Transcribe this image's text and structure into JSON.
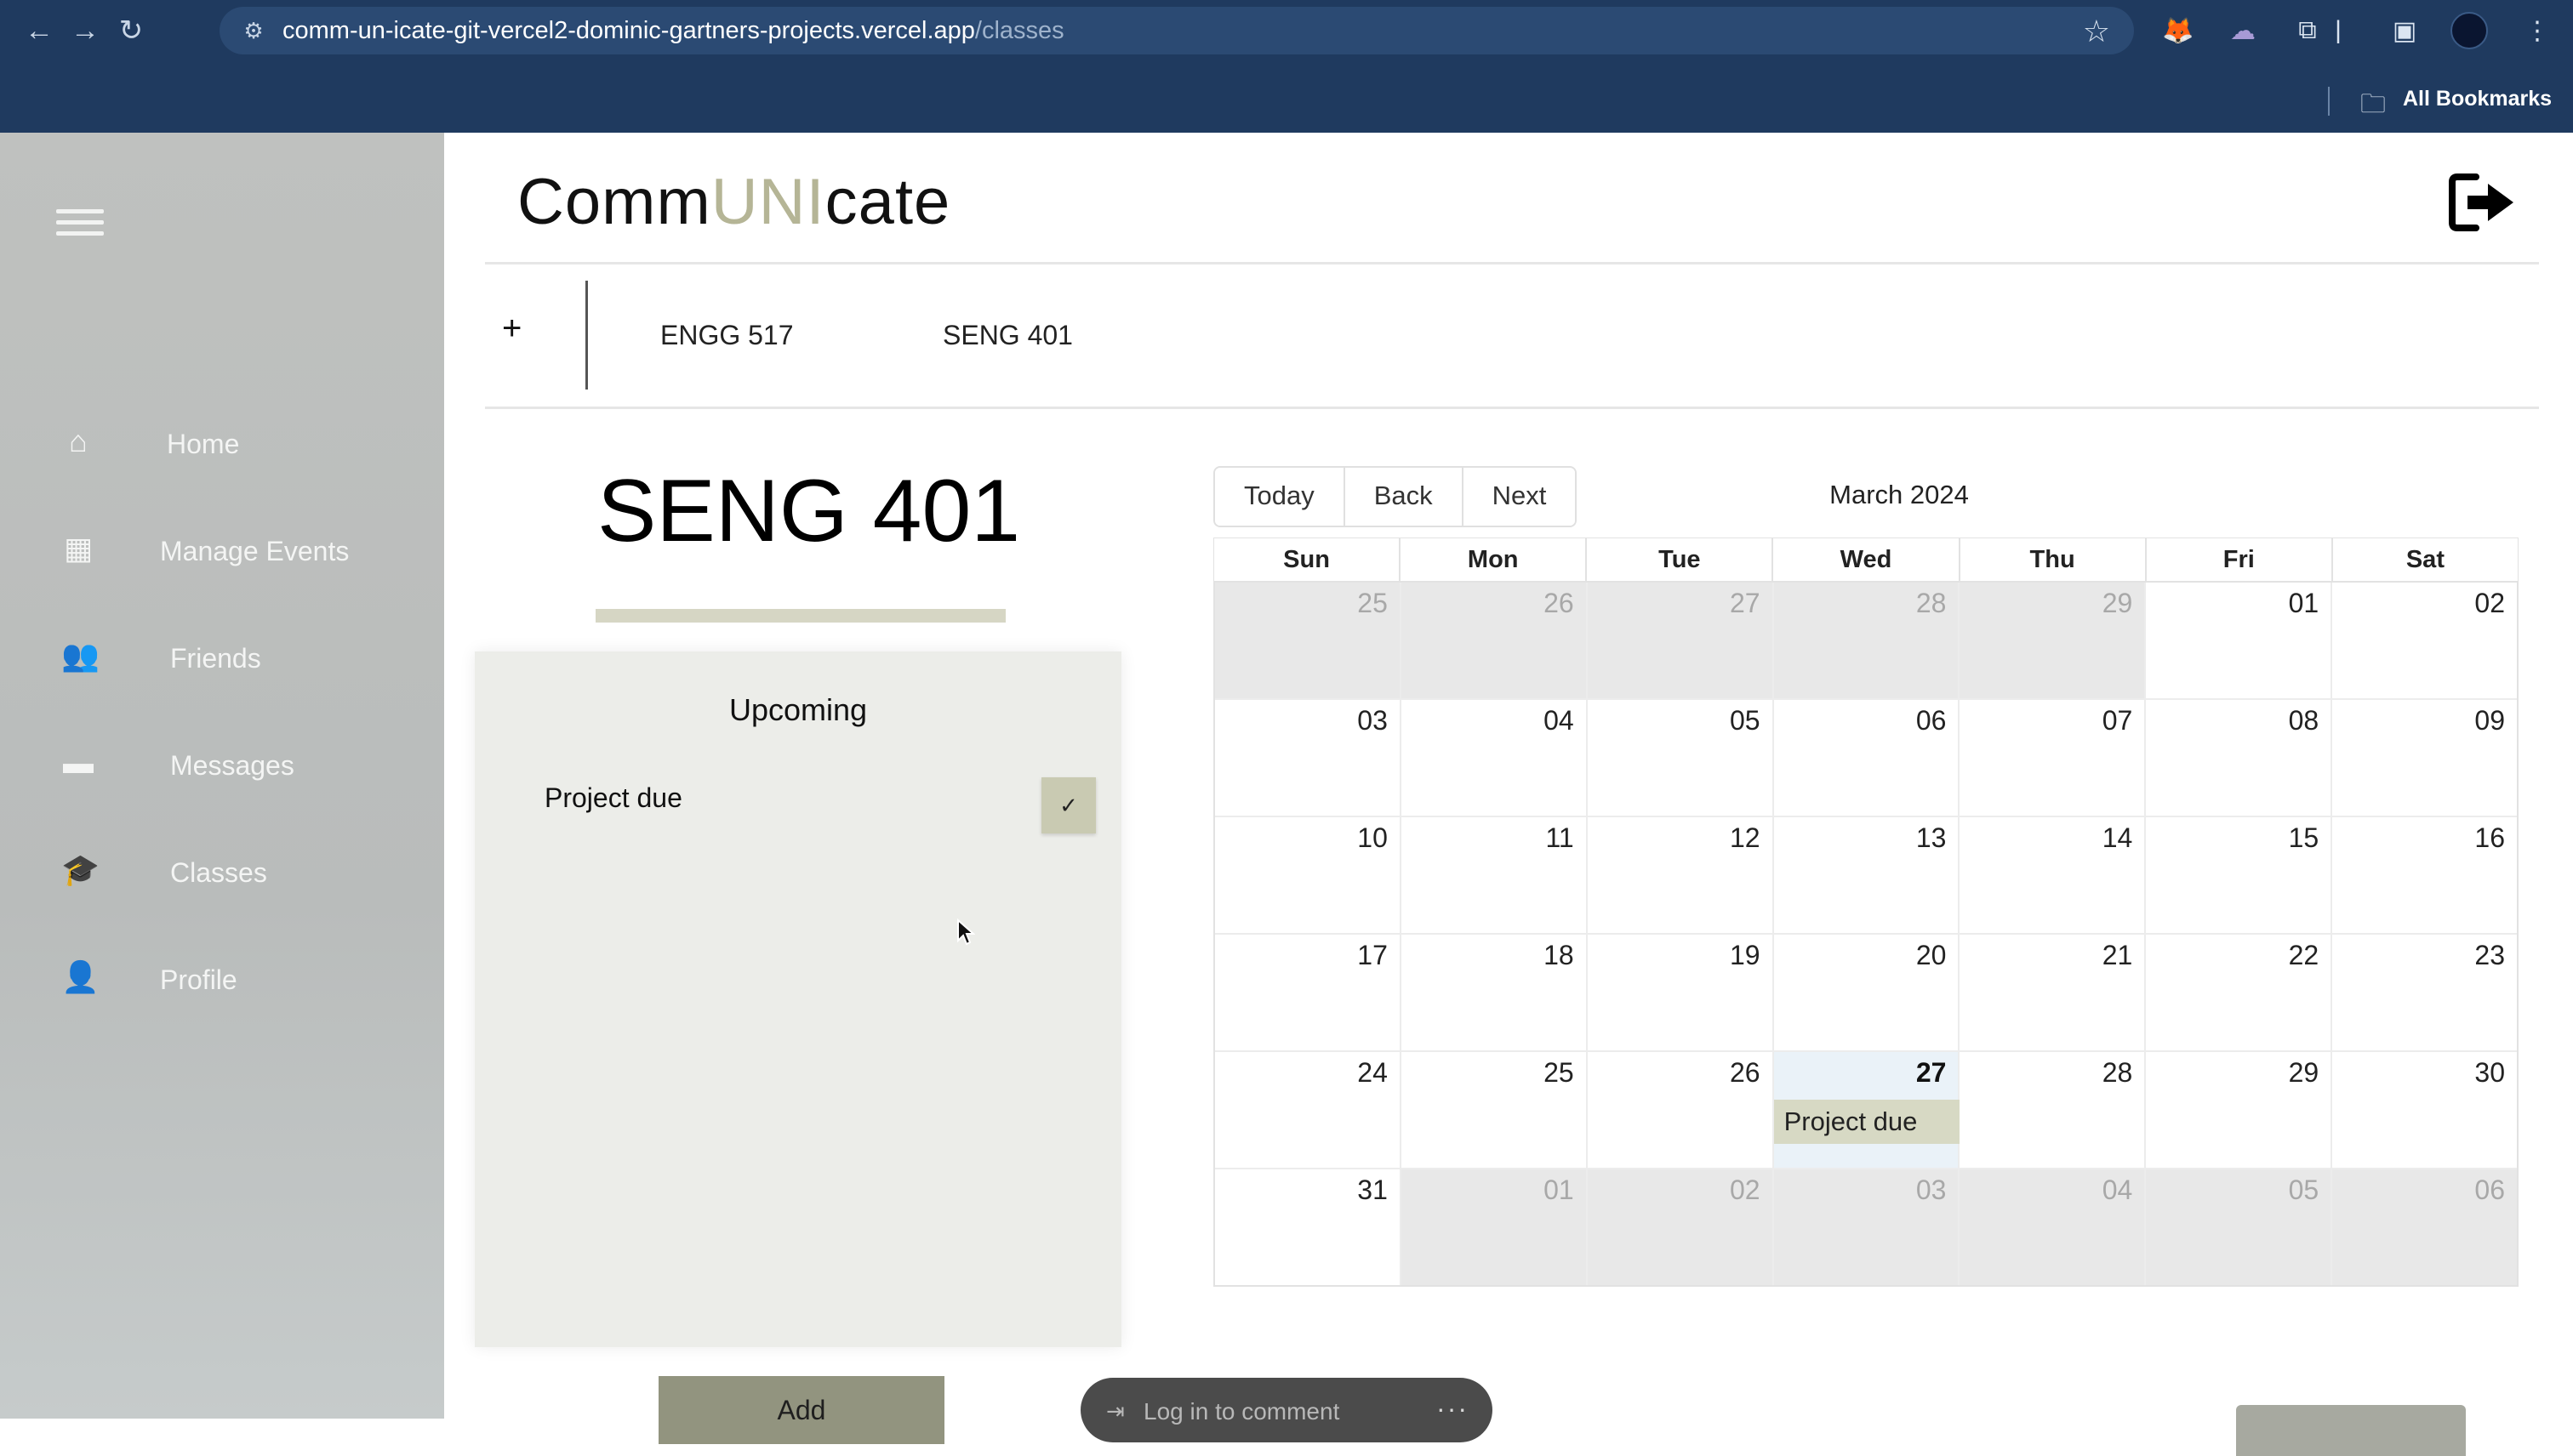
{
  "browser": {
    "url_host": "comm-un-icate-git-vercel2-dominic-gartners-projects.vercel.app",
    "url_path": "/classes",
    "bookmarks_label": "All Bookmarks"
  },
  "sidebar": {
    "items": [
      {
        "label": "Home",
        "icon": "home-icon"
      },
      {
        "label": "Manage Events",
        "icon": "calendar-icon"
      },
      {
        "label": "Friends",
        "icon": "users-icon"
      },
      {
        "label": "Messages",
        "icon": "message-icon"
      },
      {
        "label": "Classes",
        "icon": "graduation-cap-icon"
      },
      {
        "label": "Profile",
        "icon": "user-icon"
      }
    ]
  },
  "header": {
    "brand_prefix": "Comm",
    "brand_accent": "UNI",
    "brand_suffix": "cate"
  },
  "class_tabs": {
    "add": "+",
    "items": [
      "ENGG 517",
      "SENG 401"
    ]
  },
  "course": {
    "title": "SENG 401"
  },
  "upcoming": {
    "title": "Upcoming",
    "items": [
      {
        "label": "Project due",
        "check": "✓"
      }
    ],
    "add_label": "Add"
  },
  "comment": {
    "label": "Log in to comment",
    "more": "···"
  },
  "calendar": {
    "buttons": [
      "Today",
      "Back",
      "Next"
    ],
    "month_label": "March 2024",
    "weekdays": [
      "Sun",
      "Mon",
      "Tue",
      "Wed",
      "Thu",
      "Fri",
      "Sat"
    ],
    "weeks": [
      [
        "25",
        "26",
        "27",
        "28",
        "29",
        "01",
        "02"
      ],
      [
        "03",
        "04",
        "05",
        "06",
        "07",
        "08",
        "09"
      ],
      [
        "10",
        "11",
        "12",
        "13",
        "14",
        "15",
        "16"
      ],
      [
        "17",
        "18",
        "19",
        "20",
        "21",
        "22",
        "23"
      ],
      [
        "24",
        "25",
        "26",
        "27",
        "28",
        "29",
        "30"
      ],
      [
        "31",
        "01",
        "02",
        "03",
        "04",
        "05",
        "06"
      ]
    ],
    "event": {
      "label": "Project due",
      "date": "27"
    }
  },
  "colors": {
    "brand_accent": "#b5b596",
    "event_bg": "#d7d9c4",
    "add_button": "#92947f",
    "chrome": "#1f3a5f"
  }
}
